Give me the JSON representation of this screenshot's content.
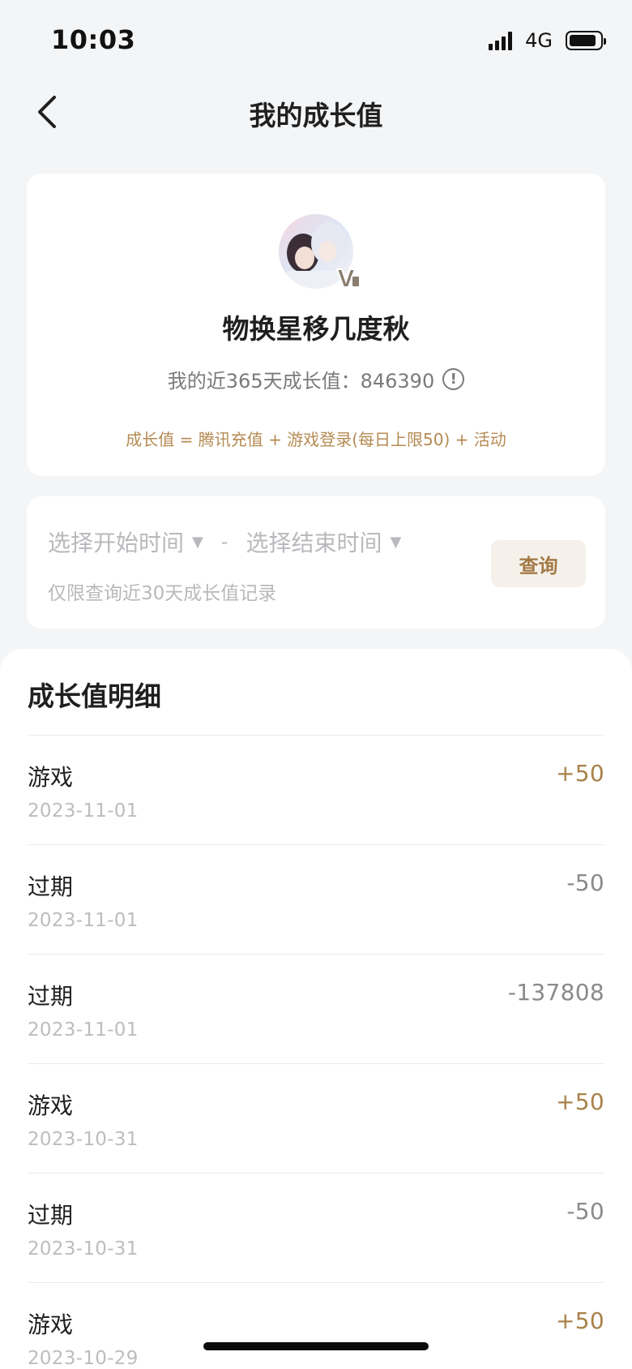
{
  "status_bar": {
    "time": "10:03",
    "network": "4G"
  },
  "nav": {
    "title": "我的成长值",
    "back_icon": "chevron-left-icon"
  },
  "profile": {
    "nickname": "物换星移几度秋",
    "growth_label": "我的近365天成长值：",
    "growth_value": "846390",
    "info_icon": "info-circle-icon",
    "formula": "成长值 = 腾讯充值 + 游戏登录(每日上限50) + 活动"
  },
  "query": {
    "start_placeholder": "选择开始时间",
    "end_placeholder": "选择结束时间",
    "separator": "-",
    "hint": "仅限查询近30天成长值记录",
    "button_label": "查询"
  },
  "detail": {
    "title": "成长值明细",
    "rows": [
      {
        "type": "游戏",
        "date": "2023-11-01",
        "amount": "+50",
        "positive": true
      },
      {
        "type": "过期",
        "date": "2023-11-01",
        "amount": "-50",
        "positive": false
      },
      {
        "type": "过期",
        "date": "2023-11-01",
        "amount": "-137808",
        "positive": false
      },
      {
        "type": "游戏",
        "date": "2023-10-31",
        "amount": "+50",
        "positive": true
      },
      {
        "type": "过期",
        "date": "2023-10-31",
        "amount": "-50",
        "positive": false
      },
      {
        "type": "游戏",
        "date": "2023-10-29",
        "amount": "+50",
        "positive": true
      }
    ]
  },
  "colors": {
    "accent": "#b58a52",
    "positive": "#a98148",
    "negative": "#8a8a8a",
    "background": "#f4f5f7"
  }
}
